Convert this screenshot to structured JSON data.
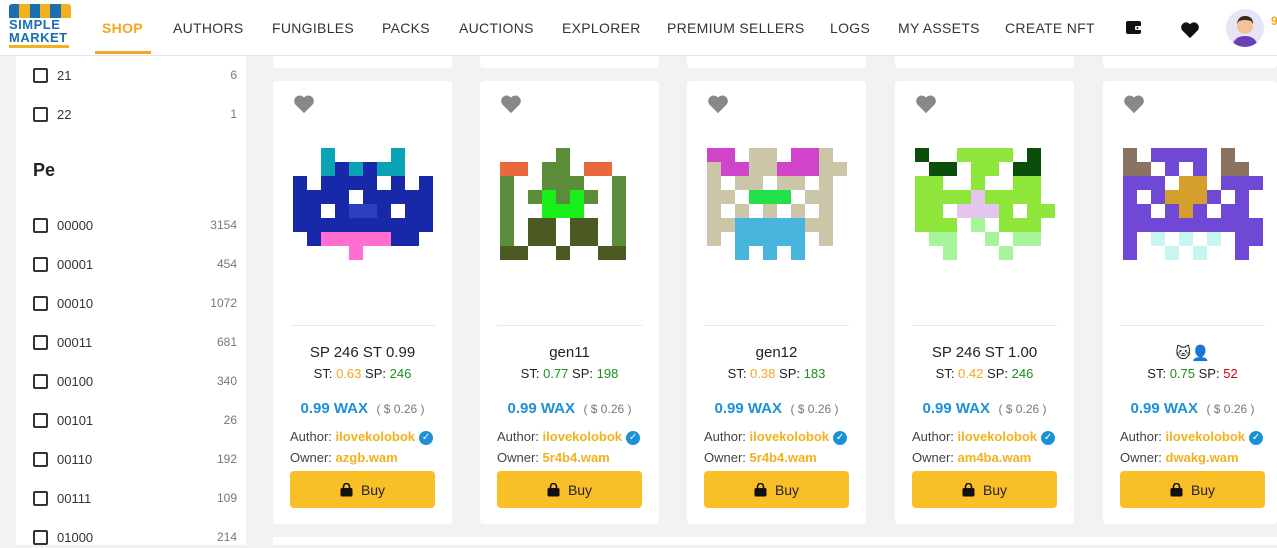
{
  "header": {
    "logo": {
      "line1": "SIMPLE",
      "line2": "MARKET"
    },
    "nav": [
      {
        "label": "SHOP",
        "active": true
      },
      {
        "label": "AUTHORS"
      },
      {
        "label": "FUNGIBLES"
      },
      {
        "label": "PACKS"
      },
      {
        "label": "AUCTIONS"
      },
      {
        "label": "EXPLORER"
      },
      {
        "label": "PREMIUM SELLERS"
      },
      {
        "label": "LOGS"
      },
      {
        "label": "MY ASSETS"
      },
      {
        "label": "CREATE NFT"
      }
    ],
    "icons": [
      "wallet-icon",
      "heart-icon"
    ],
    "user_count_partial": "9"
  },
  "sidebar": {
    "top_options": [
      {
        "label": "21",
        "count": "6"
      },
      {
        "label": "22",
        "count": "1"
      }
    ],
    "section_title": "Pe",
    "pe_options": [
      {
        "label": "00000",
        "count": "3154"
      },
      {
        "label": "00001",
        "count": "454"
      },
      {
        "label": "00010",
        "count": "1072"
      },
      {
        "label": "00011",
        "count": "681"
      },
      {
        "label": "00100",
        "count": "340"
      },
      {
        "label": "00101",
        "count": "26"
      },
      {
        "label": "00110",
        "count": "192"
      },
      {
        "label": "00111",
        "count": "109"
      },
      {
        "label": "01000",
        "count": "214"
      }
    ]
  },
  "cards": [
    {
      "name": "SP 246 ST 0.99",
      "st_label": "ST:",
      "st": "0.63",
      "st_color": "orange",
      "sp_label": "SP:",
      "sp": "246",
      "sp_color": "green",
      "price": "0.99 WAX",
      "usd": "( $ 0.26 )",
      "author_label": "Author:",
      "author": "ilovekolobok",
      "owner_label": "Owner:",
      "owner": "azgb.wam",
      "buy": "Buy"
    },
    {
      "name": "gen11",
      "st_label": "ST:",
      "st": "0.77",
      "st_color": "green",
      "sp_label": "SP:",
      "sp": "198",
      "sp_color": "green",
      "price": "0.99 WAX",
      "usd": "( $ 0.26 )",
      "author_label": "Author:",
      "author": "ilovekolobok",
      "owner_label": "Owner:",
      "owner": "5r4b4.wam",
      "buy": "Buy"
    },
    {
      "name": "gen12",
      "st_label": "ST:",
      "st": "0.38",
      "st_color": "orange",
      "sp_label": "SP:",
      "sp": "183",
      "sp_color": "green",
      "price": "0.99 WAX",
      "usd": "( $ 0.26 )",
      "author_label": "Author:",
      "author": "ilovekolobok",
      "owner_label": "Owner:",
      "owner": "5r4b4.wam",
      "buy": "Buy"
    },
    {
      "name": "SP 246 ST 1.00",
      "st_label": "ST:",
      "st": "0.42",
      "st_color": "orange",
      "sp_label": "SP:",
      "sp": "246",
      "sp_color": "green",
      "price": "0.99 WAX",
      "usd": "( $ 0.26 )",
      "author_label": "Author:",
      "author": "ilovekolobok",
      "owner_label": "Owner:",
      "owner": "am4ba.wam",
      "buy": "Buy"
    },
    {
      "name": "🐱👤",
      "st_label": "ST:",
      "st": "0.75",
      "st_color": "green",
      "sp_label": "SP:",
      "sp": "52",
      "sp_color": "red",
      "price": "0.99 WAX",
      "usd": "( $ 0.26 )",
      "author_label": "Author:",
      "author": "ilovekolobok",
      "owner_label": "Owner:",
      "owner": "dwakg.wam",
      "buy": "Buy"
    }
  ],
  "colors": {
    "accent": "#f5a623",
    "buy": "#f9bf27",
    "wax": "#1e90d8",
    "green": "#1e8e1e",
    "red": "#d0021b"
  }
}
